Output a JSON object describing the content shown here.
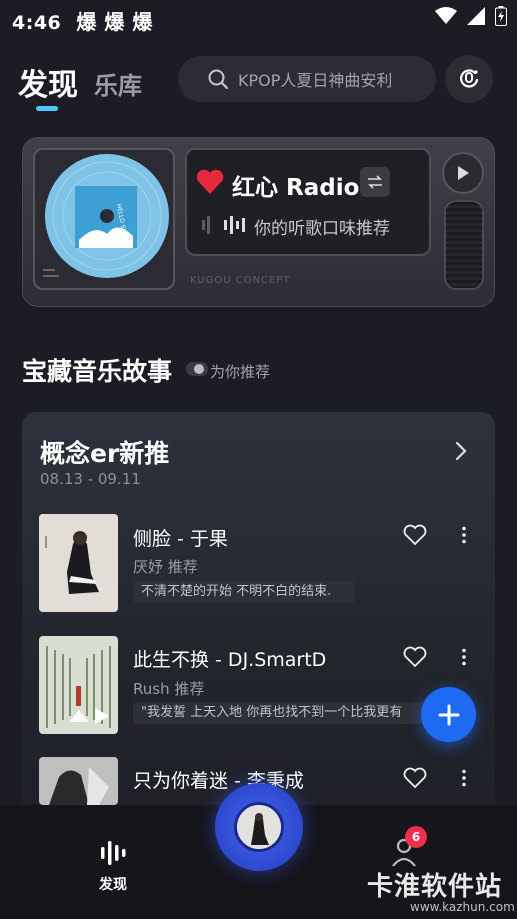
{
  "status_bar": {
    "time": "4:46",
    "notif_icons": "爆 爆 爆"
  },
  "header": {
    "tab_discover": "发现",
    "tab_library": "乐库",
    "search_placeholder": "KPOP人夏日神曲安利"
  },
  "radio": {
    "title": "红心 Radio",
    "description": "你的听歌口味推荐",
    "brand": "KUGOU CONCEPT",
    "album_text": "HELLO SUNNY"
  },
  "section": {
    "title": "宝藏音乐故事",
    "toggle_label": "为你推荐"
  },
  "playlist": {
    "title": "概念er新推",
    "date_range": "08.13 - 09.11",
    "songs": [
      {
        "title": "侧脸 - 于果",
        "recommender": "厌妤 推荐",
        "quote": "不清不楚的开始 不明不白的结束."
      },
      {
        "title": "此生不换 - DJ.SmartD",
        "recommender": "Rush 推荐",
        "quote": "\"我发誓 上天入地 你再也找不到一个比我更有"
      },
      {
        "title": "只为你着迷 - 李秉成",
        "recommender": "",
        "quote": ""
      }
    ]
  },
  "bottom_nav": {
    "home_label": "发现",
    "badge_count": "6"
  },
  "watermark": {
    "text": "卡淮软件站",
    "url": "www.kazhun.com"
  },
  "colors": {
    "accent": "#52c7ff",
    "fab": "#1c6bf2",
    "badge": "#f0304b",
    "heart": "#e8283c"
  }
}
